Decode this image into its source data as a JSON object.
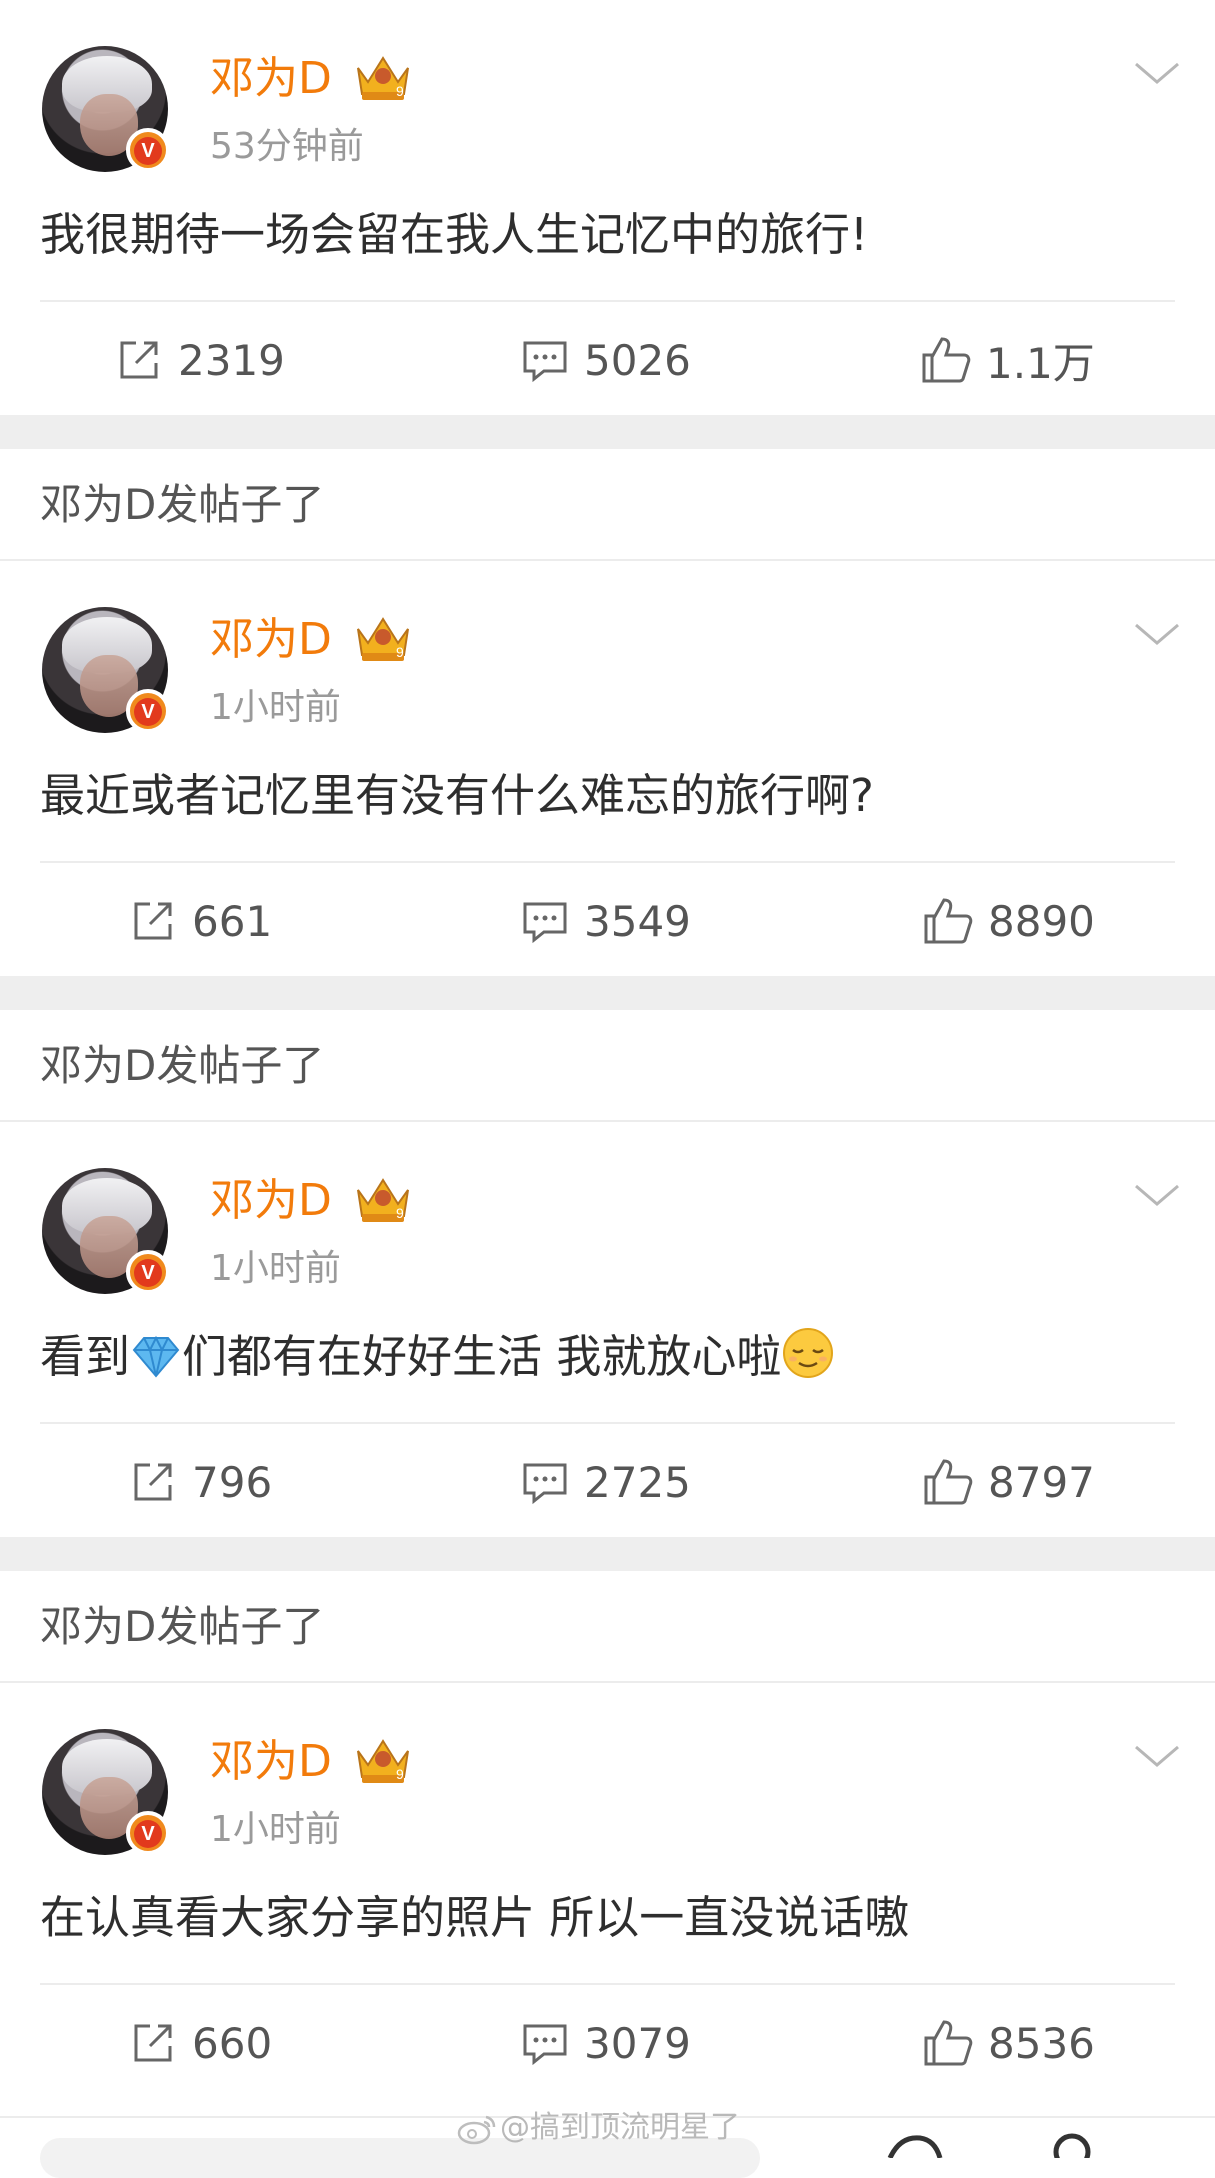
{
  "posts": [
    {
      "username": "邓为D",
      "time": "53分钟前",
      "text": "我很期待一场会留在我人生记忆中的旅行!",
      "reposts": "2319",
      "comments": "5026",
      "likes": "1.1万"
    },
    {
      "username": "邓为D",
      "time": "1小时前",
      "text": "最近或者记忆里有没有什么难忘的旅行啊?",
      "reposts": "661",
      "comments": "3549",
      "likes": "8890"
    },
    {
      "username": "邓为D",
      "time": "1小时前",
      "text_before": "看到",
      "text_after": "们都有在好好生活 我就放心啦",
      "emoji_1": "diamond-emoji",
      "emoji_2": "relieved-face-emoji",
      "reposts": "796",
      "comments": "2725",
      "likes": "8797"
    },
    {
      "username": "邓为D",
      "time": "1小时前",
      "text": "在认真看大家分享的照片 所以一直没说话嗷",
      "reposts": "660",
      "comments": "3079",
      "likes": "8536"
    }
  ],
  "section_label": "邓为D发帖子了",
  "watermark": "@搞到顶流明星了",
  "badge_letter": "V",
  "crown_level": "9",
  "colors": {
    "username": "#f27b0b",
    "badge": "#f08a1d",
    "gap": "#eeeeee",
    "meta": "#9a9a9a"
  },
  "icons": {
    "repost": "repost-icon",
    "comment": "comment-icon",
    "like": "thumbs-up-icon",
    "more": "chevron-down-icon",
    "crown": "crown-icon",
    "verified": "verified-badge-icon"
  }
}
